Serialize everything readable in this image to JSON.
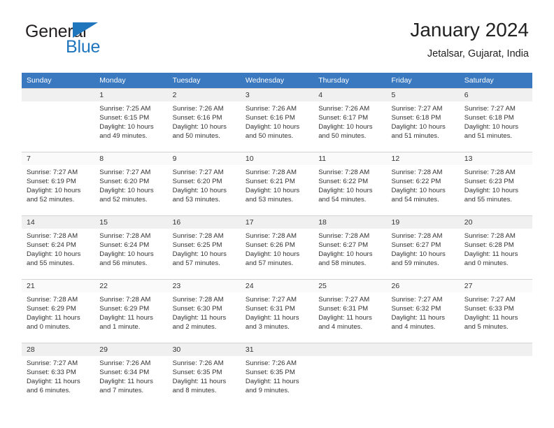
{
  "brand": {
    "name_part1": "General",
    "name_part2": "Blue",
    "accent_color": "#1f76bd",
    "flag_icon": "brand-flag-icon"
  },
  "header": {
    "title": "January 2024",
    "subtitle": "Jetalsar, Gujarat, India"
  },
  "calendar": {
    "header_bg": "#3a78bf",
    "weekday_headers": [
      "Sunday",
      "Monday",
      "Tuesday",
      "Wednesday",
      "Thursday",
      "Friday",
      "Saturday"
    ],
    "weeks": [
      [
        {
          "day": "",
          "sunrise": "",
          "sunset": "",
          "daylight1": "",
          "daylight2": ""
        },
        {
          "day": "1",
          "sunrise": "Sunrise: 7:25 AM",
          "sunset": "Sunset: 6:15 PM",
          "daylight1": "Daylight: 10 hours",
          "daylight2": "and 49 minutes."
        },
        {
          "day": "2",
          "sunrise": "Sunrise: 7:26 AM",
          "sunset": "Sunset: 6:16 PM",
          "daylight1": "Daylight: 10 hours",
          "daylight2": "and 50 minutes."
        },
        {
          "day": "3",
          "sunrise": "Sunrise: 7:26 AM",
          "sunset": "Sunset: 6:16 PM",
          "daylight1": "Daylight: 10 hours",
          "daylight2": "and 50 minutes."
        },
        {
          "day": "4",
          "sunrise": "Sunrise: 7:26 AM",
          "sunset": "Sunset: 6:17 PM",
          "daylight1": "Daylight: 10 hours",
          "daylight2": "and 50 minutes."
        },
        {
          "day": "5",
          "sunrise": "Sunrise: 7:27 AM",
          "sunset": "Sunset: 6:18 PM",
          "daylight1": "Daylight: 10 hours",
          "daylight2": "and 51 minutes."
        },
        {
          "day": "6",
          "sunrise": "Sunrise: 7:27 AM",
          "sunset": "Sunset: 6:18 PM",
          "daylight1": "Daylight: 10 hours",
          "daylight2": "and 51 minutes."
        }
      ],
      [
        {
          "day": "7",
          "sunrise": "Sunrise: 7:27 AM",
          "sunset": "Sunset: 6:19 PM",
          "daylight1": "Daylight: 10 hours",
          "daylight2": "and 52 minutes."
        },
        {
          "day": "8",
          "sunrise": "Sunrise: 7:27 AM",
          "sunset": "Sunset: 6:20 PM",
          "daylight1": "Daylight: 10 hours",
          "daylight2": "and 52 minutes."
        },
        {
          "day": "9",
          "sunrise": "Sunrise: 7:27 AM",
          "sunset": "Sunset: 6:20 PM",
          "daylight1": "Daylight: 10 hours",
          "daylight2": "and 53 minutes."
        },
        {
          "day": "10",
          "sunrise": "Sunrise: 7:28 AM",
          "sunset": "Sunset: 6:21 PM",
          "daylight1": "Daylight: 10 hours",
          "daylight2": "and 53 minutes."
        },
        {
          "day": "11",
          "sunrise": "Sunrise: 7:28 AM",
          "sunset": "Sunset: 6:22 PM",
          "daylight1": "Daylight: 10 hours",
          "daylight2": "and 54 minutes."
        },
        {
          "day": "12",
          "sunrise": "Sunrise: 7:28 AM",
          "sunset": "Sunset: 6:22 PM",
          "daylight1": "Daylight: 10 hours",
          "daylight2": "and 54 minutes."
        },
        {
          "day": "13",
          "sunrise": "Sunrise: 7:28 AM",
          "sunset": "Sunset: 6:23 PM",
          "daylight1": "Daylight: 10 hours",
          "daylight2": "and 55 minutes."
        }
      ],
      [
        {
          "day": "14",
          "sunrise": "Sunrise: 7:28 AM",
          "sunset": "Sunset: 6:24 PM",
          "daylight1": "Daylight: 10 hours",
          "daylight2": "and 55 minutes."
        },
        {
          "day": "15",
          "sunrise": "Sunrise: 7:28 AM",
          "sunset": "Sunset: 6:24 PM",
          "daylight1": "Daylight: 10 hours",
          "daylight2": "and 56 minutes."
        },
        {
          "day": "16",
          "sunrise": "Sunrise: 7:28 AM",
          "sunset": "Sunset: 6:25 PM",
          "daylight1": "Daylight: 10 hours",
          "daylight2": "and 57 minutes."
        },
        {
          "day": "17",
          "sunrise": "Sunrise: 7:28 AM",
          "sunset": "Sunset: 6:26 PM",
          "daylight1": "Daylight: 10 hours",
          "daylight2": "and 57 minutes."
        },
        {
          "day": "18",
          "sunrise": "Sunrise: 7:28 AM",
          "sunset": "Sunset: 6:27 PM",
          "daylight1": "Daylight: 10 hours",
          "daylight2": "and 58 minutes."
        },
        {
          "day": "19",
          "sunrise": "Sunrise: 7:28 AM",
          "sunset": "Sunset: 6:27 PM",
          "daylight1": "Daylight: 10 hours",
          "daylight2": "and 59 minutes."
        },
        {
          "day": "20",
          "sunrise": "Sunrise: 7:28 AM",
          "sunset": "Sunset: 6:28 PM",
          "daylight1": "Daylight: 11 hours",
          "daylight2": "and 0 minutes."
        }
      ],
      [
        {
          "day": "21",
          "sunrise": "Sunrise: 7:28 AM",
          "sunset": "Sunset: 6:29 PM",
          "daylight1": "Daylight: 11 hours",
          "daylight2": "and 0 minutes."
        },
        {
          "day": "22",
          "sunrise": "Sunrise: 7:28 AM",
          "sunset": "Sunset: 6:29 PM",
          "daylight1": "Daylight: 11 hours",
          "daylight2": "and 1 minute."
        },
        {
          "day": "23",
          "sunrise": "Sunrise: 7:28 AM",
          "sunset": "Sunset: 6:30 PM",
          "daylight1": "Daylight: 11 hours",
          "daylight2": "and 2 minutes."
        },
        {
          "day": "24",
          "sunrise": "Sunrise: 7:27 AM",
          "sunset": "Sunset: 6:31 PM",
          "daylight1": "Daylight: 11 hours",
          "daylight2": "and 3 minutes."
        },
        {
          "day": "25",
          "sunrise": "Sunrise: 7:27 AM",
          "sunset": "Sunset: 6:31 PM",
          "daylight1": "Daylight: 11 hours",
          "daylight2": "and 4 minutes."
        },
        {
          "day": "26",
          "sunrise": "Sunrise: 7:27 AM",
          "sunset": "Sunset: 6:32 PM",
          "daylight1": "Daylight: 11 hours",
          "daylight2": "and 4 minutes."
        },
        {
          "day": "27",
          "sunrise": "Sunrise: 7:27 AM",
          "sunset": "Sunset: 6:33 PM",
          "daylight1": "Daylight: 11 hours",
          "daylight2": "and 5 minutes."
        }
      ],
      [
        {
          "day": "28",
          "sunrise": "Sunrise: 7:27 AM",
          "sunset": "Sunset: 6:33 PM",
          "daylight1": "Daylight: 11 hours",
          "daylight2": "and 6 minutes."
        },
        {
          "day": "29",
          "sunrise": "Sunrise: 7:26 AM",
          "sunset": "Sunset: 6:34 PM",
          "daylight1": "Daylight: 11 hours",
          "daylight2": "and 7 minutes."
        },
        {
          "day": "30",
          "sunrise": "Sunrise: 7:26 AM",
          "sunset": "Sunset: 6:35 PM",
          "daylight1": "Daylight: 11 hours",
          "daylight2": "and 8 minutes."
        },
        {
          "day": "31",
          "sunrise": "Sunrise: 7:26 AM",
          "sunset": "Sunset: 6:35 PM",
          "daylight1": "Daylight: 11 hours",
          "daylight2": "and 9 minutes."
        },
        {
          "day": "",
          "sunrise": "",
          "sunset": "",
          "daylight1": "",
          "daylight2": ""
        },
        {
          "day": "",
          "sunrise": "",
          "sunset": "",
          "daylight1": "",
          "daylight2": ""
        },
        {
          "day": "",
          "sunrise": "",
          "sunset": "",
          "daylight1": "",
          "daylight2": ""
        }
      ]
    ]
  }
}
